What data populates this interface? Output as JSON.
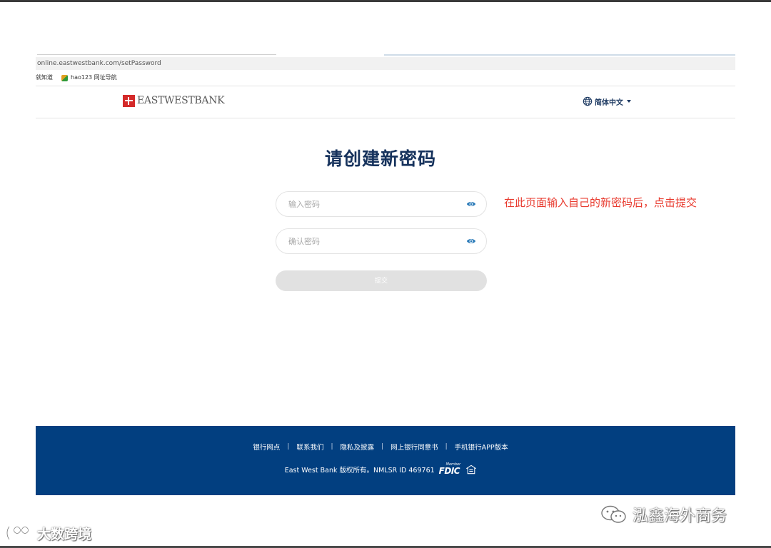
{
  "browser": {
    "url": "online.eastwestbank.com/setPassword",
    "bookmarks": [
      {
        "label": "就知道",
        "icon": "bookmark-icon"
      },
      {
        "label": "hao123 网址导航",
        "icon": "bookmark-icon"
      }
    ]
  },
  "header": {
    "logo_text": "EASTWESTBANK",
    "language_label": "简体中文",
    "language_icon": "globe-icon"
  },
  "main": {
    "title": "请创建新密码",
    "password_placeholder": "输入密码",
    "confirm_placeholder": "确认密码",
    "submit_label": "提交",
    "annotation": "在此页面输入自己的新密码后，点击提交"
  },
  "footer": {
    "links": [
      "银行网点",
      "联系我们",
      "隐私及披露",
      "网上银行同意书",
      "手机银行APP版本"
    ],
    "legal": "East West Bank 版权所有。NMLSR ID 469761",
    "fdic_member": "Member",
    "fdic_text": "FDIC"
  },
  "watermarks": {
    "right": "泓鑫海外商务",
    "left": "大数跨境"
  },
  "colors": {
    "brand_navy": "#16325c",
    "footer_blue": "#023f80",
    "annotation_red": "#e8392d",
    "logo_red": "#d42a2a",
    "eye_icon_blue": "#2a7ab8"
  }
}
